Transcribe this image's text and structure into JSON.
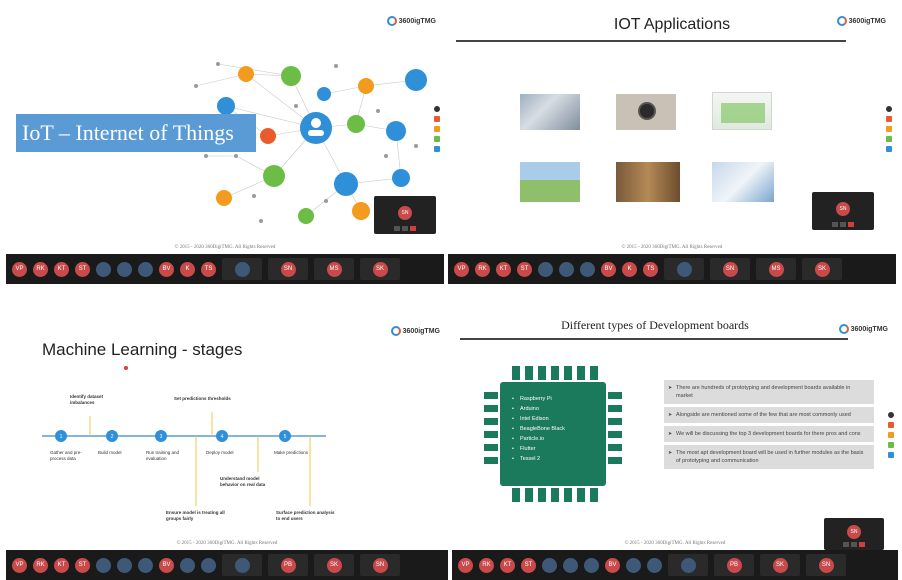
{
  "brand_label": "3600igTMG",
  "quadrants": {
    "iot_intro": {
      "title": "IoT – Internet of Things",
      "copyright": "© 2015 - 2020 360DigiTMG. All Rights Reserved",
      "self_video_initials": "SN",
      "participants": [
        "VP",
        "RK",
        "KT",
        "ST",
        "",
        "",
        "",
        "BV",
        "K",
        "TS",
        "",
        "",
        "SN",
        "MS",
        "SK"
      ]
    },
    "iot_applications": {
      "title": "IOT Applications",
      "copyright": "© 2015 - 2020 360DigiTMG. All Rights Reserved",
      "self_video_initials": "SN",
      "participants": [
        "VP",
        "RK",
        "KT",
        "ST",
        "",
        "",
        "",
        "BV",
        "K",
        "TS",
        "",
        "",
        "SN",
        "MS",
        "SK"
      ]
    },
    "ml_stages": {
      "title": "Machine Learning - stages",
      "copyright": "© 2015 - 2020 360DigiTMG. All Rights Reserved",
      "stages_above": [
        {
          "text": "Identify dataset imbalances"
        },
        {
          "text": "Set predictions thresholds"
        }
      ],
      "stages_below": [
        {
          "text": "Gather and pre-process data"
        },
        {
          "text": "Build model"
        },
        {
          "text": "Run training and evaluation"
        },
        {
          "text": "Deploy model"
        },
        {
          "text": "Make predictions"
        }
      ],
      "stages_lower": [
        {
          "text": "Understand model behavior on real data"
        },
        {
          "text": "Ensure model is treating all groups fairly"
        },
        {
          "text": "Surface prediction analysis to end users"
        }
      ],
      "node_numbers": [
        "1",
        "2",
        "3",
        "4",
        "5"
      ],
      "participants": [
        "VP",
        "RK",
        "KT",
        "ST",
        "",
        "",
        "",
        "BV",
        "",
        "",
        "",
        "",
        "PB",
        "SK",
        "SN"
      ]
    },
    "dev_boards": {
      "title": "Different types of Development boards",
      "copyright": "© 2015 - 2020 360DigiTMG. All Rights Reserved",
      "boards": [
        "Raspberry Pi",
        "Arduino",
        "Intel Edison",
        "BeagleBone Black",
        "Particle.io",
        "Flutter",
        "Tessel 2"
      ],
      "points": [
        "There are hundreds of prototyping and development boards available in market",
        "Alongside are mentioned some of the few that are most commonly used",
        "We will be discussing the top 3 development boards for there pros and cons",
        "The most apt development board will be used in further modules as the basis of prototyping and communication"
      ],
      "self_video_initials": "SN",
      "participants": [
        "VP",
        "RK",
        "KT",
        "ST",
        "",
        "",
        "",
        "BV",
        "",
        "",
        "",
        "",
        "PB",
        "SK",
        "SN"
      ]
    }
  },
  "colors": {
    "node_blue": "#2f8fd8",
    "accent_orange": "#f29b1f",
    "chip_green": "#1b7a5b",
    "title_blue": "#5b9bd5"
  }
}
